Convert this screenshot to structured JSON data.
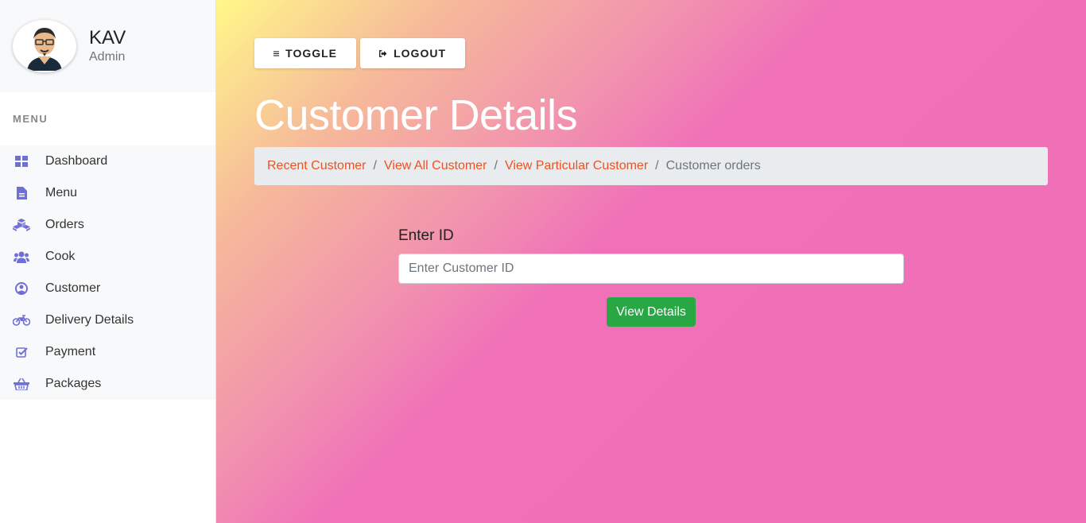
{
  "profile": {
    "name": "KAV",
    "role": "Admin"
  },
  "sidebar": {
    "heading": "MENU",
    "items": [
      {
        "label": "Dashboard",
        "icon": "dashboard-icon"
      },
      {
        "label": "Menu",
        "icon": "document-icon"
      },
      {
        "label": "Orders",
        "icon": "cubes-icon"
      },
      {
        "label": "Cook",
        "icon": "users-icon"
      },
      {
        "label": "Customer",
        "icon": "user-circle-icon"
      },
      {
        "label": "Delivery Details",
        "icon": "motorcycle-icon"
      },
      {
        "label": "Payment",
        "icon": "check-square-icon"
      },
      {
        "label": "Packages",
        "icon": "basket-icon"
      }
    ]
  },
  "toolbar": {
    "toggle_label": "TOGGLE",
    "logout_label": "LOGOUT"
  },
  "page": {
    "title": "Customer Details"
  },
  "breadcrumb": {
    "links": [
      "Recent Customer",
      "View All Customer",
      "View Particular Customer"
    ],
    "separator": "/",
    "active": "Customer orders"
  },
  "form": {
    "label": "Enter ID",
    "placeholder": "Enter Customer ID",
    "value": "",
    "button_label": "View Details"
  },
  "colors": {
    "accent": "#6f6fd8",
    "link": "#f0501f",
    "success": "#28a745",
    "gradient_start": "#fff889",
    "gradient_end": "#f070b8"
  }
}
